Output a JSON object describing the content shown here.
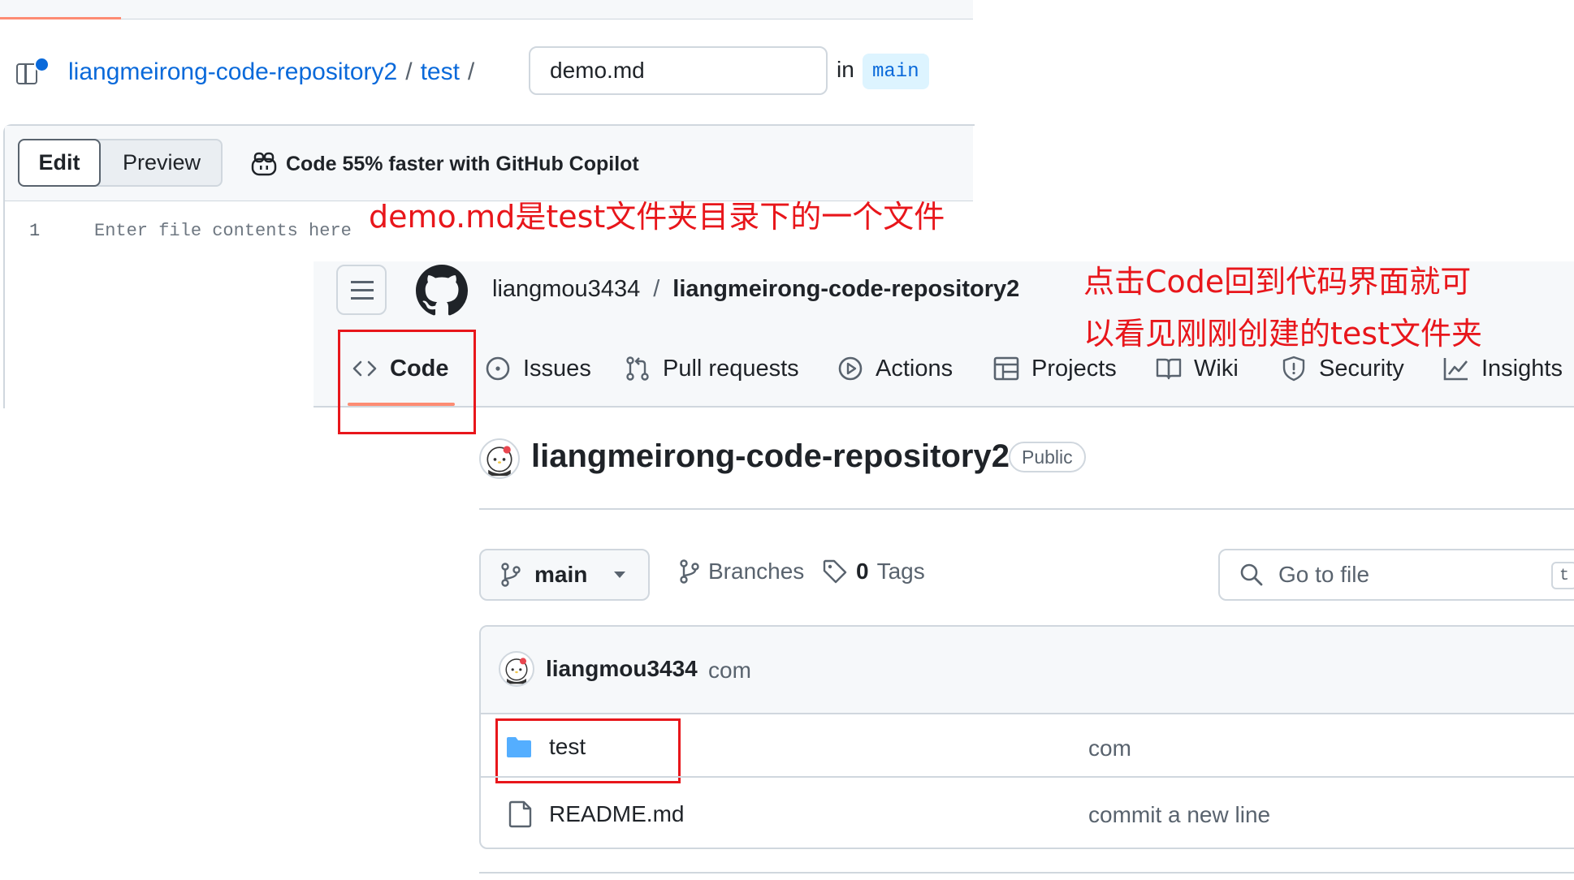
{
  "editor": {
    "path": {
      "repo": "liangmeirong-code-repository2",
      "sep": "/",
      "folder": "test"
    },
    "filename_value": "demo.md",
    "in_label": "in",
    "branch": "main",
    "tabs": {
      "edit": "Edit",
      "preview": "Preview"
    },
    "copilot_text": "Code 55% faster with GitHub Copilot",
    "line_number": "1",
    "placeholder": "Enter file contents here"
  },
  "annotations": {
    "file_note": "demo.md是test文件夹目录下的一个文件",
    "code_note_line1": "点击Code回到代码界面就可",
    "code_note_line2": "以看见刚刚创建的test文件夹"
  },
  "repo": {
    "owner": "liangmou3434",
    "slash": "/",
    "name": "liangmeirong-code-repository2",
    "visibility": "Public",
    "nav_tabs": [
      {
        "label": "Code",
        "icon": "code-icon"
      },
      {
        "label": "Issues",
        "icon": "issue-icon"
      },
      {
        "label": "Pull requests",
        "icon": "pull-request-icon"
      },
      {
        "label": "Actions",
        "icon": "actions-play-icon"
      },
      {
        "label": "Projects",
        "icon": "table-icon"
      },
      {
        "label": "Wiki",
        "icon": "book-icon"
      },
      {
        "label": "Security",
        "icon": "shield-icon"
      },
      {
        "label": "Insights",
        "icon": "graph-icon"
      }
    ],
    "branch_button": "main",
    "branches_label": "Branches",
    "tags_count": "0",
    "tags_label": "Tags",
    "goto_placeholder": "Go to file",
    "goto_shortcut": "t",
    "latest_commit": {
      "author": "liangmou3434",
      "message": "com"
    },
    "files": [
      {
        "name": "test",
        "type": "folder",
        "message": "com"
      },
      {
        "name": "README.md",
        "type": "file",
        "message": "commit a new line"
      }
    ]
  },
  "colors": {
    "annotation_red": "#e8161b",
    "link_blue": "#0969da",
    "tab_underline": "#fd8c73",
    "folder_blue": "#54aeff"
  }
}
